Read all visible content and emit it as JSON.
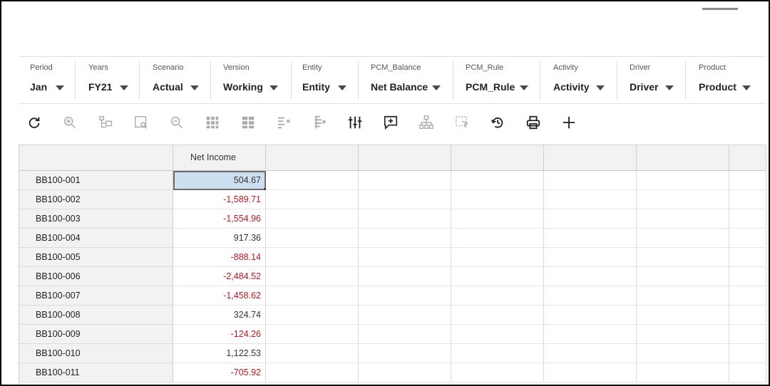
{
  "pov": [
    {
      "label": "Period",
      "value": "Jan"
    },
    {
      "label": "Years",
      "value": "FY21"
    },
    {
      "label": "Scenario",
      "value": "Actual"
    },
    {
      "label": "Version",
      "value": "Working"
    },
    {
      "label": "Entity",
      "value": "Entity"
    },
    {
      "label": "PCM_Balance",
      "value": "Net Balance"
    },
    {
      "label": "PCM_Rule",
      "value": "PCM_Rule"
    },
    {
      "label": "Activity",
      "value": "Activity"
    },
    {
      "label": "Driver",
      "value": "Driver"
    },
    {
      "label": "Product",
      "value": "Product"
    }
  ],
  "toolbar": {
    "icons": [
      "refresh-icon",
      "zoom-in-icon",
      "keep-selected-icon",
      "zoom-to-fit-icon",
      "zoom-out-icon",
      "pivot-grid-icon",
      "grid-layout-icon",
      "suppress-rows-icon",
      "suppress-columns-icon",
      "adjust-icon",
      "add-comment-icon",
      "hierarchy-icon",
      "select-region-icon",
      "history-icon",
      "print-icon",
      "add-icon"
    ]
  },
  "grid": {
    "column_header": "Net Income",
    "rows": [
      {
        "name": "BB100-001",
        "value": "504.67",
        "negative": false
      },
      {
        "name": "BB100-002",
        "value": "-1,589.71",
        "negative": true
      },
      {
        "name": "BB100-003",
        "value": "-1,554.96",
        "negative": true
      },
      {
        "name": "BB100-004",
        "value": "917.36",
        "negative": false
      },
      {
        "name": "BB100-005",
        "value": "-888.14",
        "negative": true
      },
      {
        "name": "BB100-006",
        "value": "-2,484.52",
        "negative": true
      },
      {
        "name": "BB100-007",
        "value": "-1,458.62",
        "negative": true
      },
      {
        "name": "BB100-008",
        "value": "324.74",
        "negative": false
      },
      {
        "name": "BB100-009",
        "value": "-124.26",
        "negative": true
      },
      {
        "name": "BB100-010",
        "value": "1,122.53",
        "negative": false
      },
      {
        "name": "BB100-011",
        "value": "-705.92",
        "negative": true
      }
    ]
  },
  "colors": {
    "negative": "#c0161d",
    "selection": "#cde0f2",
    "header_bg": "#f2f2f2"
  }
}
